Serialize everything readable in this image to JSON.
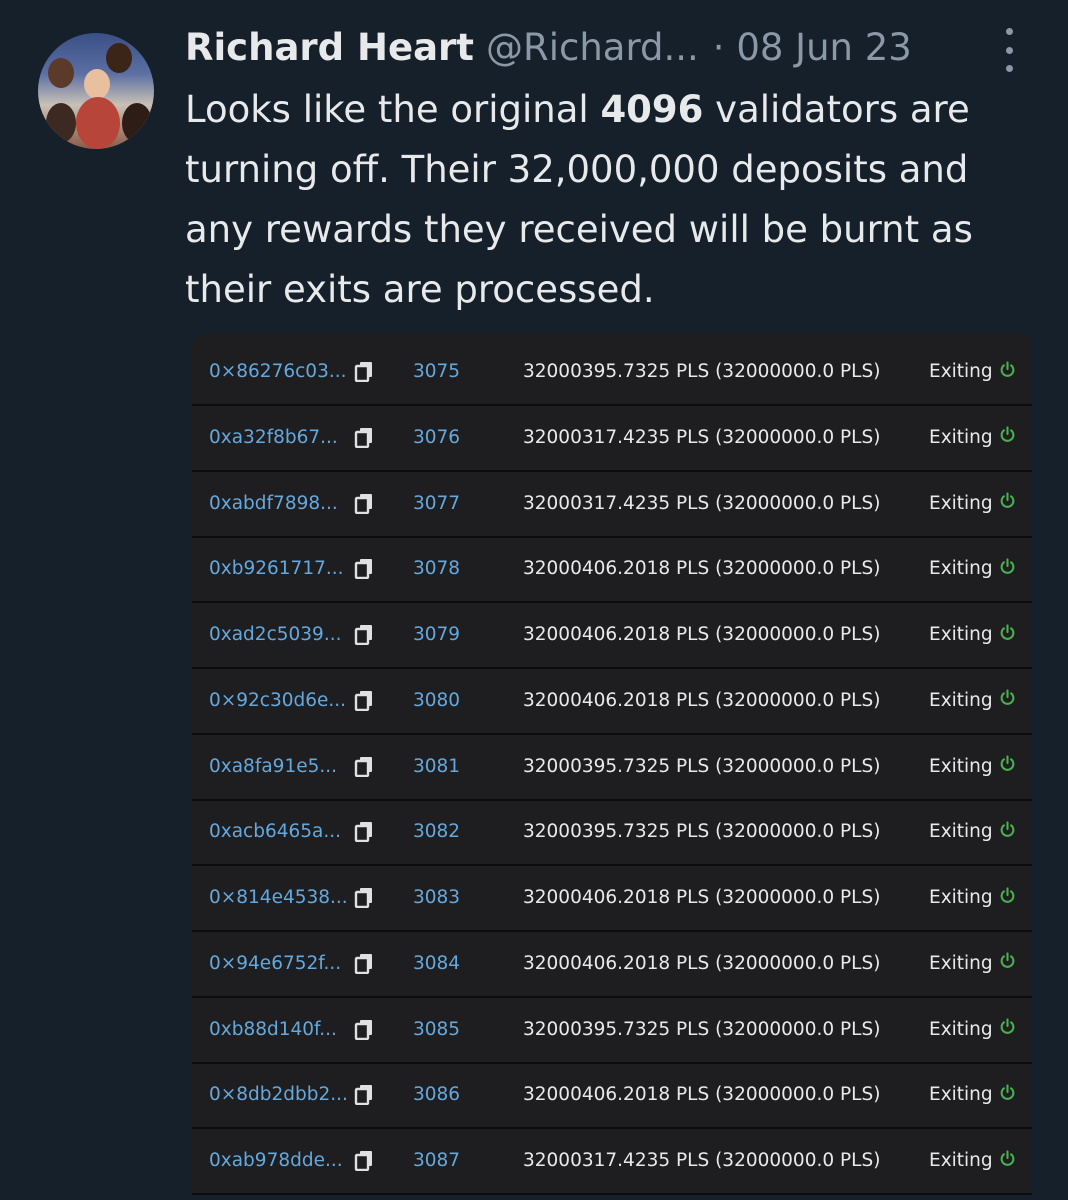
{
  "tweet": {
    "author_name": "Richard Heart",
    "handle": "@Richard...",
    "date": "· 08 Jun 23",
    "text_part1": "Looks like the original ",
    "text_bold": "4096",
    "text_part2": " validators are turning off. Their 32,000,000 deposits and any rewards they received will be burnt as their exits are processed."
  },
  "colors": {
    "background": "#15202b",
    "link_blue": "#64a8dd",
    "status_green": "#4caf50",
    "muted": "#8b98a5"
  },
  "validators": [
    {
      "address": "0×86276c03...",
      "index": "3075",
      "balance": "32000395.7325 PLS (32000000.0 PLS)",
      "status": "Exiting"
    },
    {
      "address": "0xa32f8b67...",
      "index": "3076",
      "balance": "32000317.4235 PLS (32000000.0 PLS)",
      "status": "Exiting"
    },
    {
      "address": "0xabdf7898...",
      "index": "3077",
      "balance": "32000317.4235 PLS (32000000.0 PLS)",
      "status": "Exiting"
    },
    {
      "address": "0xb9261717...",
      "index": "3078",
      "balance": "32000406.2018 PLS (32000000.0 PLS)",
      "status": "Exiting"
    },
    {
      "address": "0xad2c5039...",
      "index": "3079",
      "balance": "32000406.2018 PLS (32000000.0 PLS)",
      "status": "Exiting"
    },
    {
      "address": "0×92c30d6e...",
      "index": "3080",
      "balance": "32000406.2018 PLS (32000000.0 PLS)",
      "status": "Exiting"
    },
    {
      "address": "0xa8fa91e5...",
      "index": "3081",
      "balance": "32000395.7325 PLS (32000000.0 PLS)",
      "status": "Exiting"
    },
    {
      "address": "0xacb6465a...",
      "index": "3082",
      "balance": "32000395.7325 PLS (32000000.0 PLS)",
      "status": "Exiting"
    },
    {
      "address": "0×814e4538...",
      "index": "3083",
      "balance": "32000406.2018 PLS (32000000.0 PLS)",
      "status": "Exiting"
    },
    {
      "address": "0×94e6752f...",
      "index": "3084",
      "balance": "32000406.2018 PLS (32000000.0 PLS)",
      "status": "Exiting"
    },
    {
      "address": "0xb88d140f...",
      "index": "3085",
      "balance": "32000395.7325 PLS (32000000.0 PLS)",
      "status": "Exiting"
    },
    {
      "address": "0×8db2dbb2...",
      "index": "3086",
      "balance": "32000406.2018 PLS (32000000.0 PLS)",
      "status": "Exiting"
    },
    {
      "address": "0xab978dde...",
      "index": "3087",
      "balance": "32000317.4235 PLS (32000000.0 PLS)",
      "status": "Exiting"
    }
  ],
  "icons": {
    "copy": "copy-icon",
    "status": "power-icon",
    "more": "more-options-icon"
  }
}
